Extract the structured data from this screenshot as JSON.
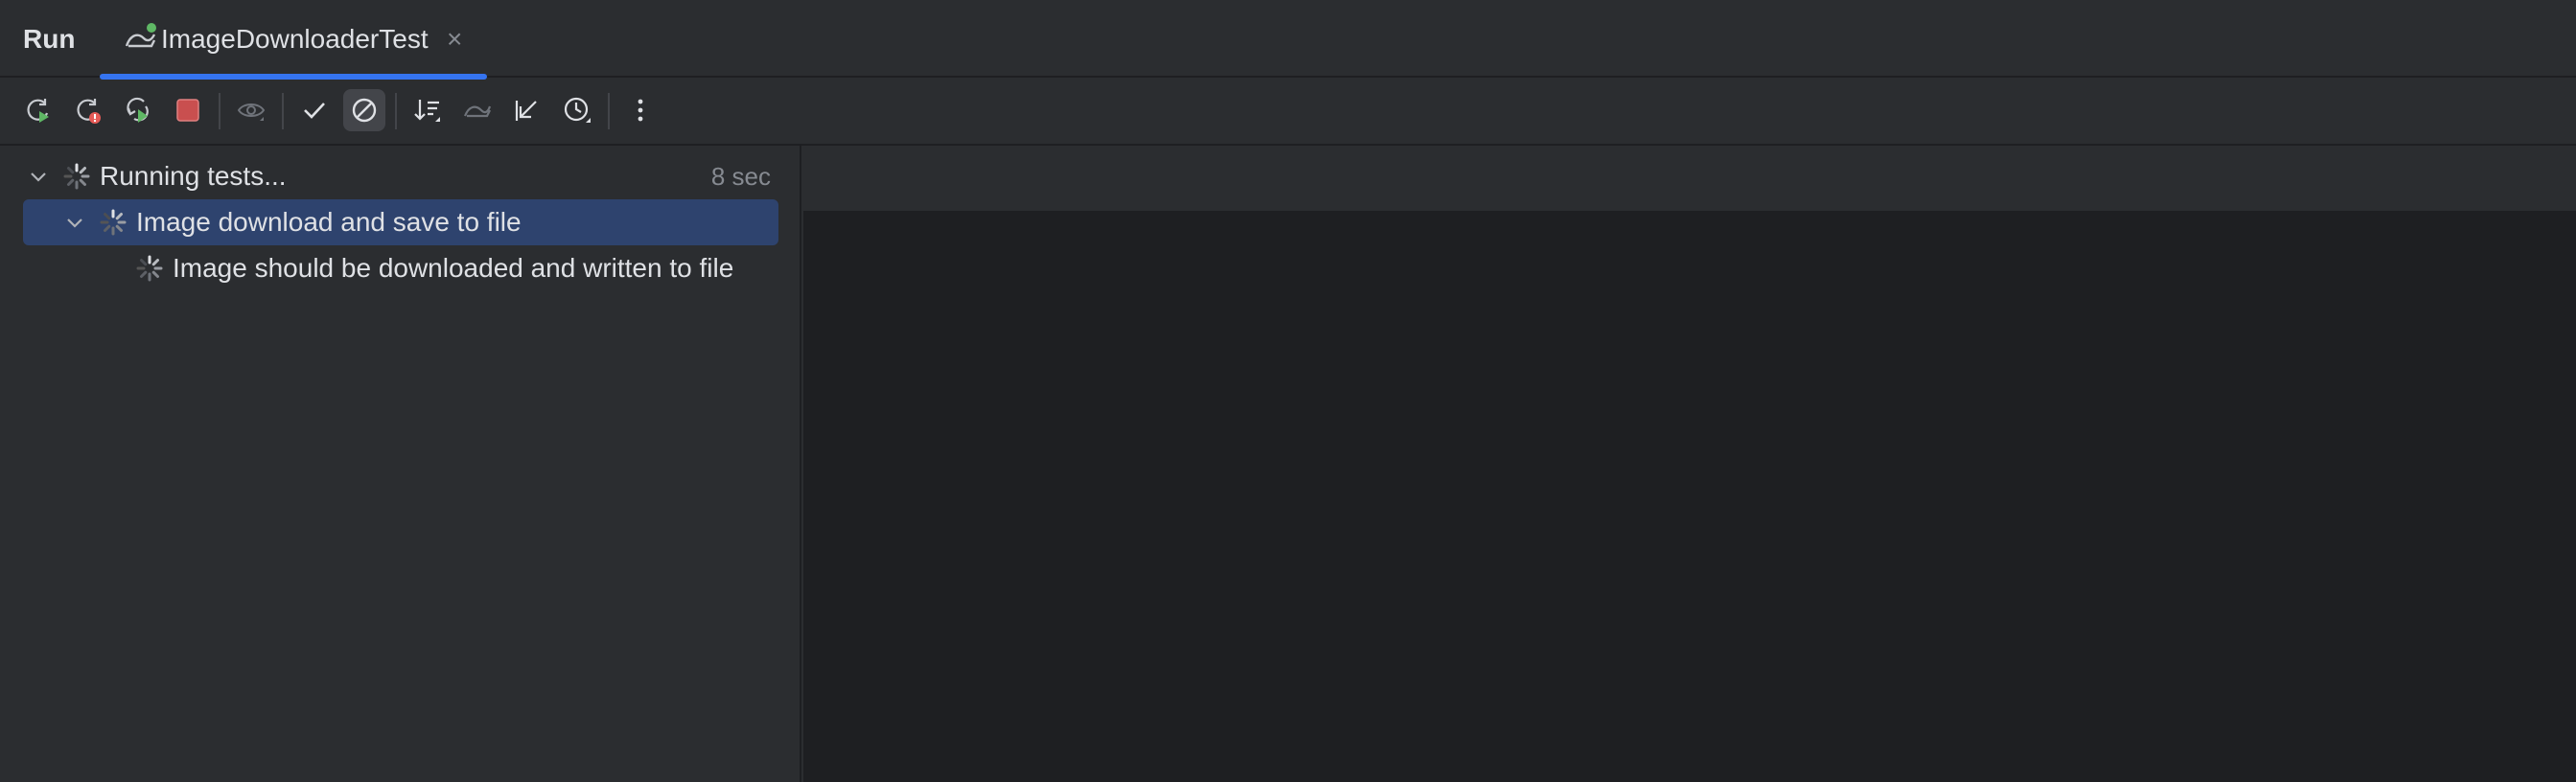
{
  "header": {
    "run_label": "Run",
    "tab_title": "ImageDownloaderTest",
    "tab_close": "×"
  },
  "toolbar": {
    "buttons": [
      {
        "name": "rerun",
        "icon": "rerun-icon"
      },
      {
        "name": "rerun-failed",
        "icon": "rerun-failed-icon"
      },
      {
        "name": "toggle-auto-test",
        "icon": "auto-test-icon"
      },
      {
        "name": "stop",
        "icon": "stop-icon"
      },
      {
        "name": "show-ignored",
        "icon": "eye-icon"
      },
      {
        "name": "show-passed",
        "icon": "check-icon"
      },
      {
        "name": "show-ignored-tests",
        "icon": "ban-icon",
        "active": true
      },
      {
        "name": "sort",
        "icon": "sort-icon"
      },
      {
        "name": "import-tests",
        "icon": "import-icon"
      },
      {
        "name": "collapse",
        "icon": "arrow-down-left-icon"
      },
      {
        "name": "history",
        "icon": "history-clock-icon"
      },
      {
        "name": "more",
        "icon": "more-vertical-icon"
      }
    ]
  },
  "tree": {
    "root": {
      "label": "Running tests...",
      "time": "8 sec"
    },
    "suite": {
      "label": "Image download and save to file"
    },
    "test": {
      "label": "Image should be downloaded and written to file"
    }
  },
  "colors": {
    "accent": "#3574f0",
    "selection": "#2e436e",
    "run_green": "#5fb865",
    "error_red": "#e55b57",
    "stop_red": "#c94f4f"
  }
}
